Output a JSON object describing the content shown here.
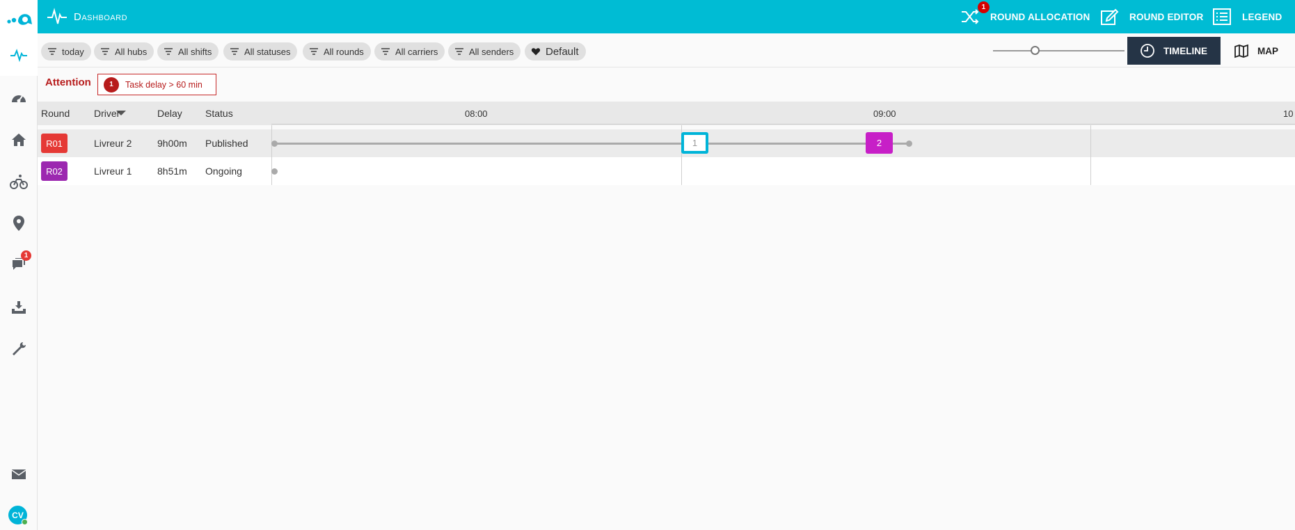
{
  "app": {
    "title": "Dashboard"
  },
  "topbar": {
    "round_allocation": {
      "label": "ROUND ALLOCATION",
      "badge": "1"
    },
    "round_editor": {
      "label": "ROUND EDITOR"
    },
    "legend": {
      "label": "LEGEND"
    }
  },
  "sidebar": {
    "items": [
      {
        "icon": "activity-icon",
        "active": true
      },
      {
        "icon": "speedometer-icon"
      },
      {
        "icon": "home-icon"
      },
      {
        "icon": "bicycle-icon"
      },
      {
        "icon": "location-pin-icon"
      },
      {
        "icon": "chat-icon",
        "badge": "1"
      },
      {
        "icon": "download-tray-icon"
      },
      {
        "icon": "wrench-icon"
      },
      {
        "icon": "mail-icon"
      }
    ],
    "avatar_initials": "CV"
  },
  "filters": [
    {
      "label": "today"
    },
    {
      "label": "All hubs"
    },
    {
      "label": "All shifts"
    },
    {
      "label": "All statuses"
    },
    {
      "label": "All rounds"
    },
    {
      "label": "All carriers"
    },
    {
      "label": "All senders"
    },
    {
      "label": "Default"
    }
  ],
  "views": {
    "timeline": "TIMELINE",
    "map": "MAP",
    "active": "timeline"
  },
  "attention": {
    "label": "Attention",
    "alert_count": "1",
    "alert_text": "Task delay > 60 min"
  },
  "table": {
    "columns": [
      "Round",
      "Driver",
      "Delay",
      "Status"
    ],
    "timeline_labels": [
      "08:00",
      "09:00",
      "10"
    ],
    "rows": [
      {
        "round": "R01",
        "round_color": "#e53935",
        "driver": "Livreur 2",
        "delay": "9h00m",
        "status": "Published",
        "tasks": [
          "1",
          "2"
        ]
      },
      {
        "round": "R02",
        "round_color": "#9c27b0",
        "driver": "Livreur 1",
        "delay": "8h51m",
        "status": "Ongoing",
        "tasks": []
      }
    ]
  },
  "colors": {
    "accent": "#00bcd4",
    "timeline_active": "#253446",
    "alert": "#b71c1c"
  }
}
